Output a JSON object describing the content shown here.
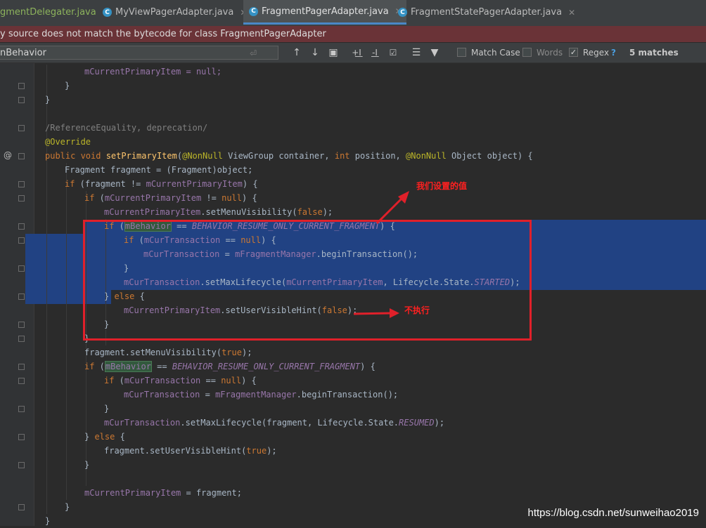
{
  "tabs": [
    {
      "label": "gmentDelegater.java",
      "active": false,
      "icon": "none"
    },
    {
      "label": "MyViewPagerAdapter.java",
      "active": false,
      "icon": "class-icon"
    },
    {
      "label": "FragmentPagerAdapter.java",
      "active": true,
      "icon": "class-icon"
    },
    {
      "label": "FragmentStatePagerAdapter.java",
      "active": false,
      "icon": "class-icon"
    }
  ],
  "warning": "y source does not match the bytecode for class FragmentPagerAdapter",
  "search": {
    "value": "nBehavior",
    "match_case_label": "Match Case",
    "words_label": "Words",
    "regex_label": "Regex",
    "help": "?",
    "matches": "5 matches",
    "match_case": false,
    "words": false,
    "regex": true
  },
  "gutter": {
    "override_marker": "@"
  },
  "code": {
    "l1": "mCurrentPrimaryItem = null;",
    "l2": "}",
    "l3": "}",
    "l5": "/ReferenceEquality, deprecation/",
    "l6": "@Override",
    "l7a": "public void ",
    "l7b": "setPrimaryItem",
    "l7c": "(",
    "l7d": "@NonNull",
    "l7e": " ViewGroup container, ",
    "l7f": "int",
    "l7g": " position, ",
    "l7h": "@NonNull",
    "l7i": " Object object) {",
    "l8": "Fragment fragment = (Fragment)object;",
    "l9a": "if",
    "l9b": " (fragment != ",
    "l9c": "mCurrentPrimaryItem",
    "l9d": ") {",
    "l10a": "if",
    "l10b": " (",
    "l10c": "mCurrentPrimaryItem",
    "l10d": " != ",
    "l10e": "null",
    "l10f": ") {",
    "l11a": "mCurrentPrimaryItem",
    "l11b": ".setMenuVisibility(",
    "l11c": "false",
    "l11d": ");",
    "l12a": "if",
    "l12b": " (",
    "l12c": "mBehavior",
    "l12d": " == ",
    "l12e": "BEHAVIOR_RESUME_ONLY_CURRENT_FRAGMENT",
    "l12f": ") {",
    "l13a": "if",
    "l13b": " (",
    "l13c": "mCurTransaction",
    "l13d": " == ",
    "l13e": "null",
    "l13f": ") {",
    "l14a": "mCurTransaction",
    "l14b": " = ",
    "l14c": "mFragmentManager",
    "l14d": ".beginTransaction();",
    "l15": "}",
    "l16a": "mCurTransaction",
    "l16b": ".setMaxLifecycle(",
    "l16c": "mCurrentPrimaryItem",
    "l16d": ", Lifecycle.State.",
    "l16e": "STARTED",
    "l16f": ");",
    "l17a": "} ",
    "l17b": "else",
    "l17c": " {",
    "l18a": "mCurrentPrimaryItem",
    "l18b": ".setUserVisibleHint(",
    "l18c": "false",
    "l18d": ");",
    "l19": "}",
    "l20": "}",
    "l21a": "fragment.setMenuVisibility(",
    "l21b": "true",
    "l21c": ");",
    "l22a": "if",
    "l22b": " (",
    "l22c": "mBehavior",
    "l22d": " == ",
    "l22e": "BEHAVIOR_RESUME_ONLY_CURRENT_FRAGMENT",
    "l22f": ") {",
    "l23a": "if",
    "l23b": " (",
    "l23c": "mCurTransaction",
    "l23d": " == ",
    "l23e": "null",
    "l23f": ") {",
    "l24a": "mCurTransaction",
    "l24b": " = ",
    "l24c": "mFragmentManager",
    "l24d": ".beginTransaction();",
    "l25": "}",
    "l26a": "mCurTransaction",
    "l26b": ".setMaxLifecycle(fragment, Lifecycle.State.",
    "l26c": "RESUMED",
    "l26d": ");",
    "l27a": "} ",
    "l27b": "else",
    "l27c": " {",
    "l28a": "fragment.setUserVisibleHint(",
    "l28b": "true",
    "l28c": ");",
    "l29": "}",
    "l31a": "mCurrentPrimaryItem",
    "l31b": " = fragment;",
    "l32": "}",
    "l33": "}"
  },
  "annotations": {
    "note1": "我们设置的值",
    "note2": "不执行",
    "color": "#e0202a"
  },
  "watermark": "https://blog.csdn.net/sunweihao2019"
}
